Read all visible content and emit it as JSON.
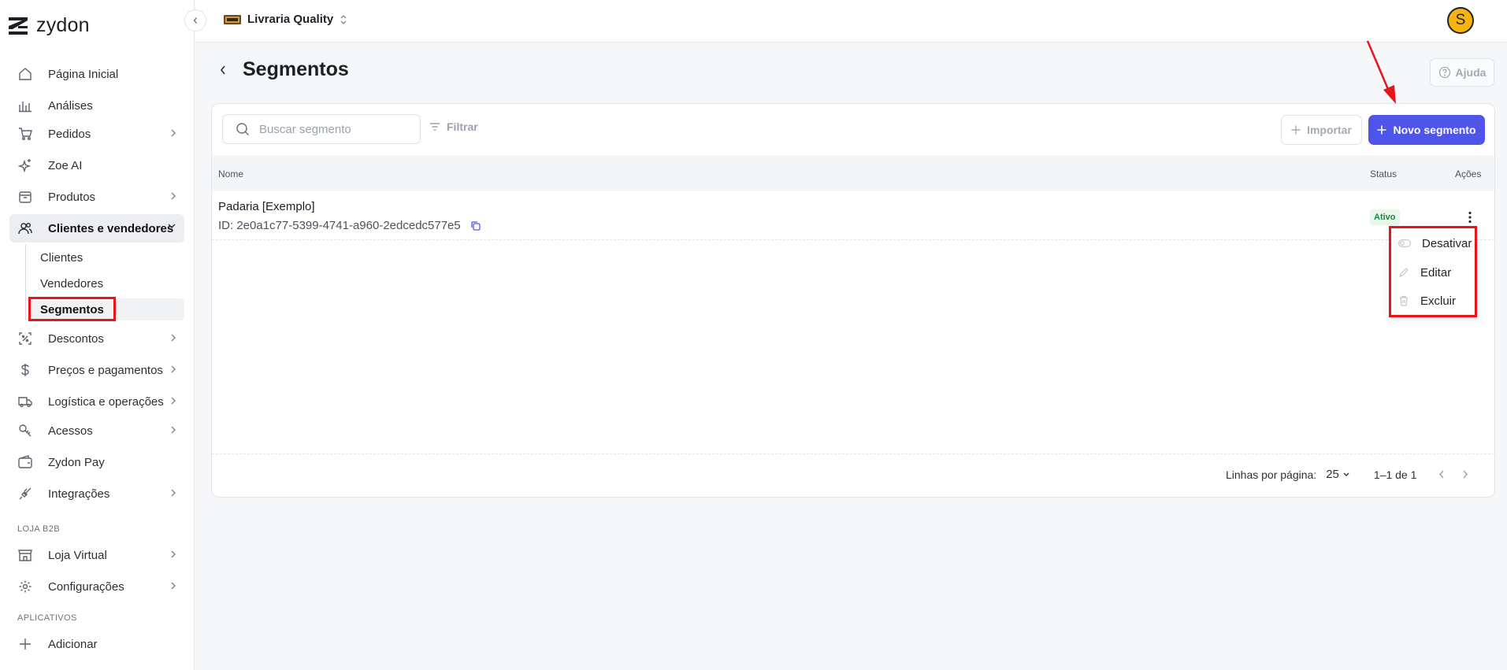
{
  "app": {
    "name": "zydon"
  },
  "topbar": {
    "store_name": "Livraria Quality",
    "avatar_initial": "S"
  },
  "sidebar": {
    "items": [
      {
        "label": "Página Inicial",
        "icon": "home-icon"
      },
      {
        "label": "Análises",
        "icon": "chart-bars-icon"
      },
      {
        "label": "Pedidos",
        "icon": "cart-icon"
      },
      {
        "label": "Zoe AI",
        "icon": "sparkles-icon"
      },
      {
        "label": "Produtos",
        "icon": "box-icon"
      },
      {
        "label": "Clientes e vendedores",
        "icon": "users-icon"
      },
      {
        "label": "Descontos",
        "icon": "discount-icon"
      },
      {
        "label": "Preços e pagamentos",
        "icon": "dollar-icon"
      },
      {
        "label": "Logística e operações",
        "icon": "truck-icon"
      },
      {
        "label": "Acessos",
        "icon": "key-icon"
      },
      {
        "label": "Zydon Pay",
        "icon": "wallet-icon"
      },
      {
        "label": "Integrações",
        "icon": "plug-icon"
      },
      {
        "label": "Loja Virtual",
        "icon": "store-icon"
      },
      {
        "label": "Configurações",
        "icon": "gear-icon"
      },
      {
        "label": "Adicionar",
        "icon": "plus-icon"
      }
    ],
    "subitems": [
      {
        "label": "Clientes"
      },
      {
        "label": "Vendedores"
      },
      {
        "label": "Segmentos"
      }
    ],
    "sections": {
      "b2b": "LOJA B2B",
      "apps": "APLICATIVOS"
    }
  },
  "page": {
    "title": "Segmentos",
    "help_label": "Ajuda"
  },
  "toolbar": {
    "search_placeholder": "Buscar segmento",
    "filter_label": "Filtrar",
    "import_label": "Importar",
    "new_label": "Novo segmento"
  },
  "table": {
    "columns": {
      "name": "Nome",
      "status": "Status",
      "actions": "Ações"
    },
    "rows": [
      {
        "name": "Padaria [Exemplo]",
        "id": "ID: 2e0a1c77-5399-4741-a960-2edcedc577e5",
        "status": "Ativo"
      }
    ]
  },
  "context_menu": {
    "items": [
      {
        "label": "Desativar",
        "icon": "toggle-icon"
      },
      {
        "label": "Editar",
        "icon": "pencil-icon"
      },
      {
        "label": "Excluir",
        "icon": "trash-icon"
      }
    ]
  },
  "pagination": {
    "rows_per_page_label": "Linhas por página:",
    "rows_per_page": "25",
    "range": "1–1 de 1"
  },
  "colors": {
    "primary": "#4f55e9",
    "highlight": "#e8141c",
    "status_active": "#1a8a3a",
    "avatar": "#f6b40e"
  }
}
